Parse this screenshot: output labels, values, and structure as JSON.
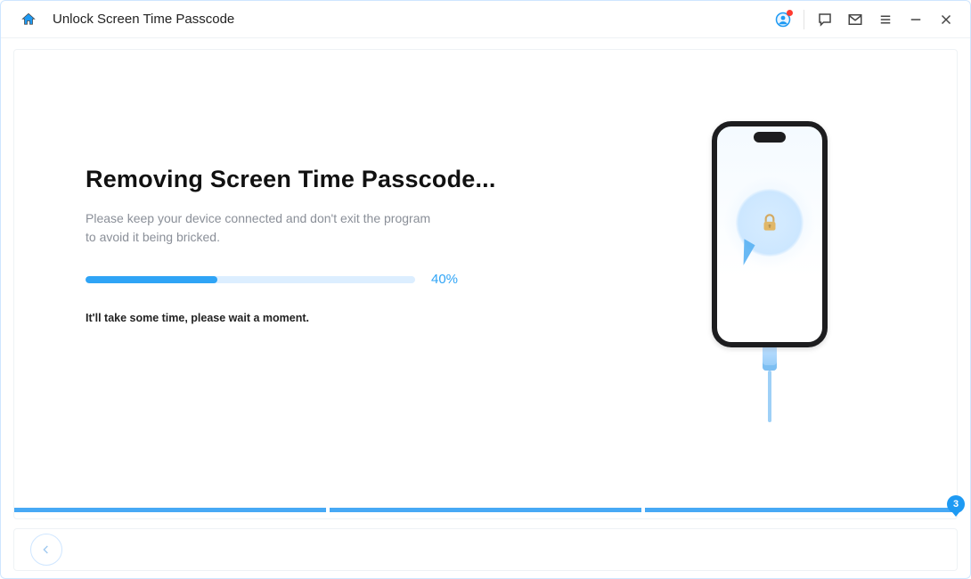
{
  "header": {
    "title": "Unlock Screen Time Passcode"
  },
  "main": {
    "heading": "Removing Screen Time Passcode...",
    "subtext": "Please keep your device connected and don't exit the program to avoid it being bricked.",
    "progress_percent": 40,
    "progress_label": "40%",
    "wait_note": "It'll take some time, please wait a moment."
  },
  "steps": {
    "total": 3,
    "current": 3,
    "badge_label": "3"
  },
  "colors": {
    "accent": "#2fa4f6",
    "accent_dark": "#1e9af3",
    "progress_track": "#dceeff",
    "text_muted": "#8a8f98",
    "lock_gold": "#f5a623"
  },
  "icons": {
    "home": "home-icon",
    "account": "account-icon",
    "feedback": "speech-bubble-icon",
    "mail": "mail-icon",
    "menu": "menu-icon",
    "minimize": "minimize-icon",
    "close": "close-icon",
    "back": "arrow-left-icon",
    "phone_lock": "padlock-icon"
  }
}
